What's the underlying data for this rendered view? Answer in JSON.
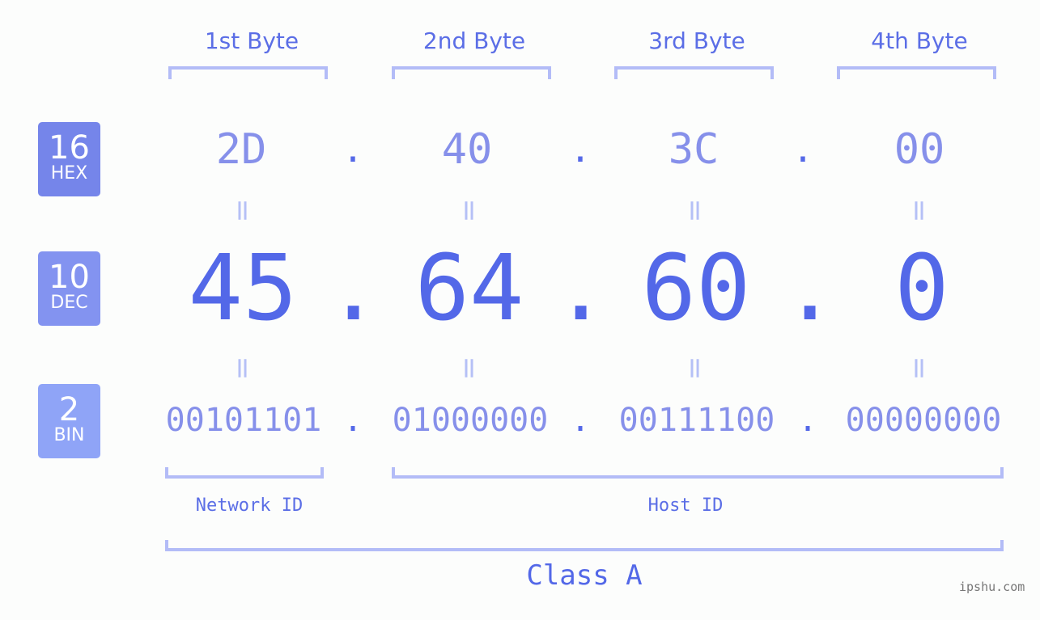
{
  "byte_headers": [
    "1st Byte",
    "2nd Byte",
    "3rd Byte",
    "4th Byte"
  ],
  "badges": [
    {
      "num": "16",
      "label": "HEX",
      "color": "#7585ea"
    },
    {
      "num": "10",
      "label": "DEC",
      "color": "#8393f0"
    },
    {
      "num": "2",
      "label": "BIN",
      "color": "#8fa4f7"
    }
  ],
  "hex": [
    "2D",
    "40",
    "3C",
    "00"
  ],
  "dec": [
    "45",
    "64",
    "60",
    "0"
  ],
  "bin": [
    "00101101",
    "01000000",
    "00111100",
    "00000000"
  ],
  "separator": ".",
  "equals": "=",
  "network_label": "Network ID",
  "host_label": "Host ID",
  "class_label": "Class A",
  "watermark": "ipshu.com",
  "colors": {
    "primary": "#5368e8",
    "light": "#8690ea",
    "bracket": "#b3bcf7"
  }
}
